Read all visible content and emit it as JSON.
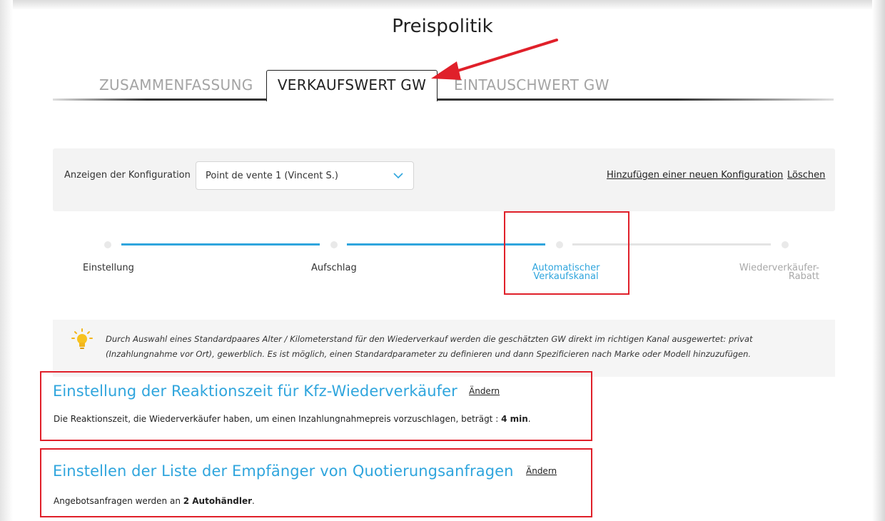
{
  "page": {
    "title": "Preispolitik"
  },
  "tabs": [
    {
      "label": "ZUSAMMENFASSUNG",
      "active": false
    },
    {
      "label": "VERKAUFSWERT GW",
      "active": true
    },
    {
      "label": "EINTAUSCHWERT GW",
      "active": false
    }
  ],
  "config": {
    "label": "Anzeigen der Konfiguration",
    "selected": "Point de vente 1 (Vincent S.)",
    "add_link": "Hinzufügen einer neuen Konfiguration",
    "delete_link": "Löschen"
  },
  "stepper": {
    "current_step": 3,
    "steps": [
      {
        "label": "Einstellung",
        "state": "done"
      },
      {
        "label": "Aufschlag",
        "state": "done"
      },
      {
        "label_line1": "Automatischer",
        "label_line2": "Verkaufskanal",
        "state": "active"
      },
      {
        "label_line1": "Wiederverkäufer-",
        "label_line2": "Rabatt",
        "state": "todo"
      }
    ]
  },
  "info": {
    "icon": "lightbulb-icon",
    "text": "Durch Auswahl eines Standardpaares Alter / Kilometerstand für den Wiederverkauf werden die geschätzten GW  direkt im richtigen Kanal ausgewertet: privat (Inzahlungnahme vor Ort), gewerblich. Es ist möglich, einen Standardparameter zu definieren und dann Spezificieren  nach Marke oder Modell hinzuzufügen."
  },
  "sections": [
    {
      "title": "Einstellung der Reaktionszeit für Kfz-Wiederverkäufer",
      "change_label": "Ändern",
      "text_before": "Die Reaktionszeit, die Wiederverkäufer haben, um einen Inzahlungnahmepreis vorzuschlagen, beträgt : ",
      "value": "4 min",
      "text_after": "."
    },
    {
      "title": "Einstellen der Liste der Empfänger von Quotierungsanfragen",
      "change_label": "Ändern",
      "text_before": "Angebotsanfragen werden an ",
      "value": "2 Autohändler",
      "text_after": "."
    }
  ],
  "colors": {
    "accent": "#2fa5dd",
    "annotation": "#e0202a",
    "panel_bg": "#f3f3f3"
  }
}
